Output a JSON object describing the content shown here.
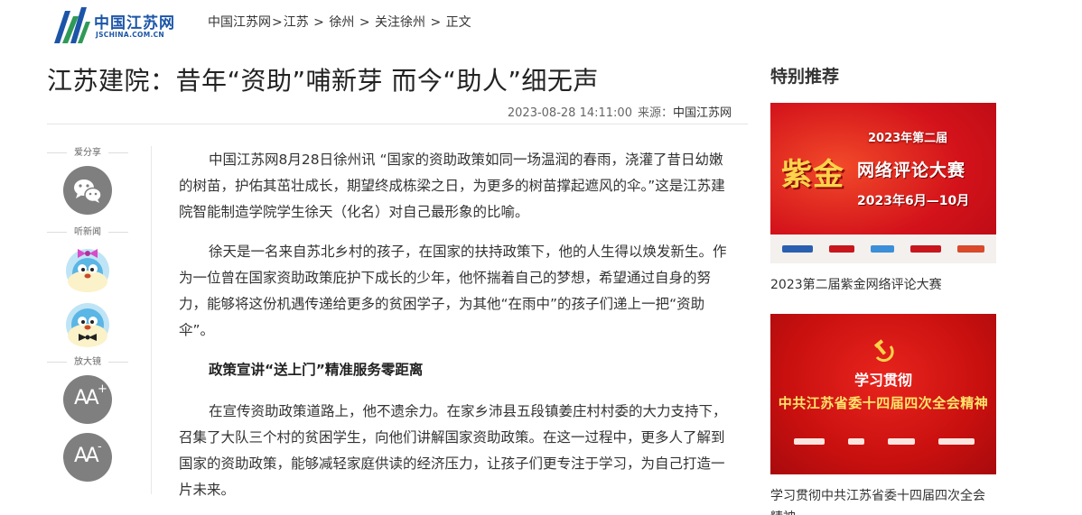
{
  "site": {
    "logo_text": "中国江苏网",
    "logo_sub": "JSCHINA.COM.CN"
  },
  "breadcrumb": [
    {
      "label": "中国江苏网"
    },
    {
      "label": "江苏"
    },
    {
      "label": "徐州"
    },
    {
      "label": "关注徐州"
    },
    {
      "label": "正文"
    }
  ],
  "breadcrumb_separators": [
    ">",
    " > ",
    " > ",
    " > "
  ],
  "article": {
    "title": "江苏建院：昔年“资助”哺新芽 而今“助人”细无声",
    "datetime": "2023-08-28 14:11:00",
    "source_label": "来源：",
    "source": "中国江苏网",
    "paragraphs": [
      "中国江苏网8月28日徐州讯 “国家的资助政策如同一场温润的春雨，浇灌了昔日幼嫩的树苗，护佑其茁壮成长，期望终成栋梁之日，为更多的树苗撑起遮风的伞。”这是江苏建院智能制造学院学生徐天（化名）对自己最形象的比喻。",
      "徐天是一名来自苏北乡村的孩子，在国家的扶持政策下，他的人生得以焕发新生。作为一位曾在国家资助政策庇护下成长的少年，他怀揣着自己的梦想，希望通过自身的努力，能够将这份机遇传递给更多的贫困学子，为其他“在雨中”的孩子们递上一把“资助伞”。",
      "政策宣讲“送上门”精准服务零距离",
      "在宣传资助政策道路上，他不遗余力。在家乡沛县五段镇姜庄村村委的大力支持下，召集了大队三个村的贫困学生，向他们讲解国家资助政策。在这一过程中，更多人了解到国家的资助政策，能够减轻家庭供读的经济压力，让孩子们更专注于学习，为自己打造一片未来。"
    ]
  },
  "share_sidebar": {
    "share_label": "爱分享",
    "listen_label": "听新闻",
    "zoom_label": "放大镜",
    "zoom_in_text": "A",
    "zoom_in_sup": "+",
    "zoom_out_text": "A",
    "zoom_out_sup": "-",
    "icons": [
      "wechat-icon",
      "female-voice-mascot-icon",
      "male-voice-mascot-icon",
      "zoom-in-icon",
      "zoom-out-icon"
    ]
  },
  "recommend": {
    "title": "特别推荐",
    "cards": [
      {
        "caption": "2023第二届紫金网络评论大赛",
        "banner_line1": "2023年第二届",
        "banner_big": "紫金",
        "banner_line2": "网络评论大赛",
        "banner_date": "2023年6月—10月"
      },
      {
        "caption": "学习贯彻中共江苏省委十四届四次全会精神",
        "banner_line1": "学习贯彻",
        "banner_line2": "中共江苏省委十四届四次全会精神"
      }
    ]
  },
  "colors": {
    "logo_blue": "#1c55a8",
    "logo_green": "#2f9a57",
    "banner_red": "#d3121a",
    "banner_gold": "#ffd34a",
    "share_grey": "#7f7f7f"
  }
}
